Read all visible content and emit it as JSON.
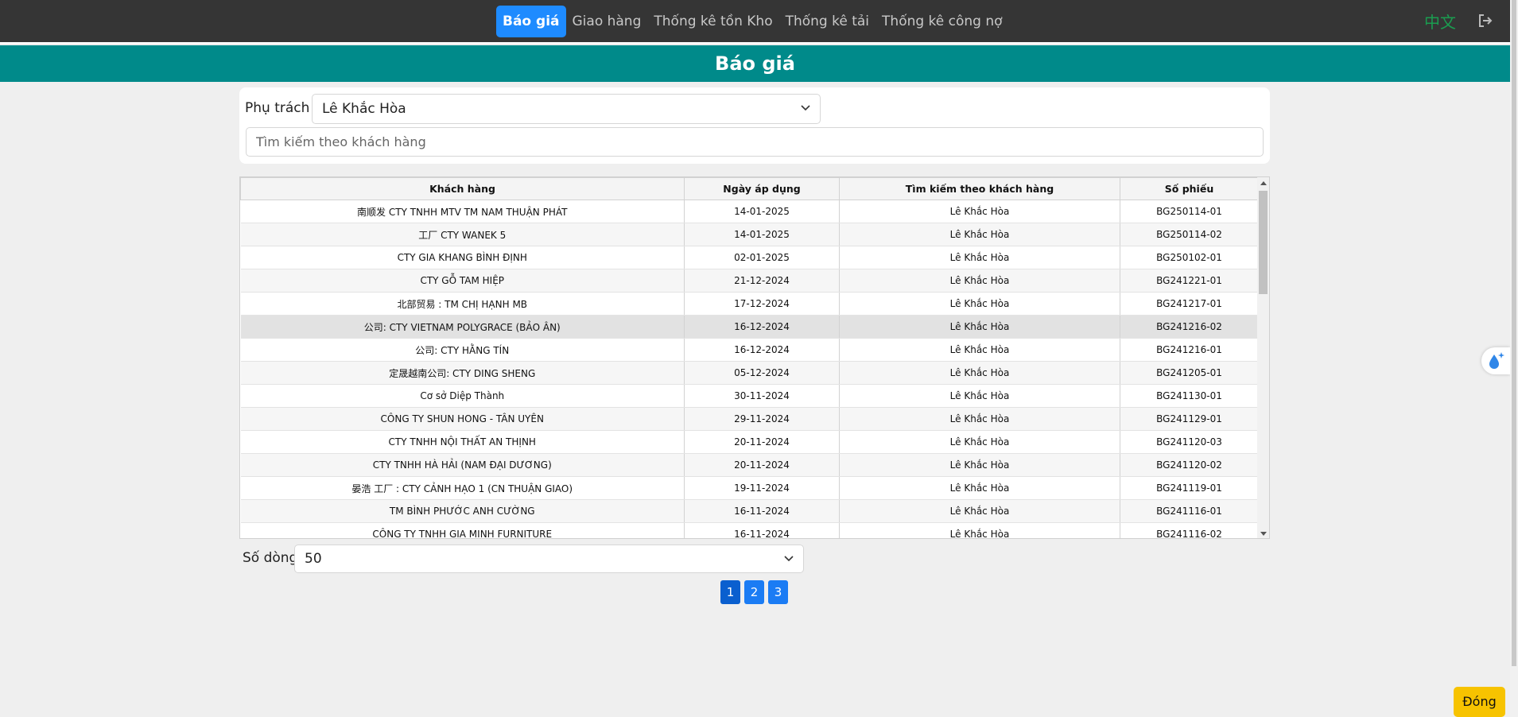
{
  "nav": {
    "tabs": [
      "Báo giá",
      "Giao hàng",
      "Thống kê tồn Kho",
      "Thống kê tải",
      "Thống kê công nợ"
    ],
    "active_index": 0,
    "language": "中文",
    "logout_icon": "logout-icon"
  },
  "page_title": "Báo giá",
  "filter": {
    "label": "Phụ trách",
    "selected": "Lê Khắc Hòa",
    "search_placeholder": "Tìm kiếm theo khách hàng"
  },
  "table": {
    "columns": [
      "Khách hàng",
      "Ngày áp dụng",
      "Tìm kiếm theo khách hàng",
      "Số phiếu"
    ],
    "rows": [
      [
        "南顺发 CTY TNHH MTV TM NAM THUẬN PHÁT",
        "14-01-2025",
        "Lê Khắc Hòa",
        "BG250114-01"
      ],
      [
        "工厂 CTY WANEK 5",
        "14-01-2025",
        "Lê Khắc Hòa",
        "BG250114-02"
      ],
      [
        "CTY GIA KHANG BÌNH ĐỊNH",
        "02-01-2025",
        "Lê Khắc Hòa",
        "BG250102-01"
      ],
      [
        "CTY GỖ TAM HIỆP",
        "21-12-2024",
        "Lê Khắc Hòa",
        "BG241221-01"
      ],
      [
        "北部贸易 : TM CHỊ HẠNH MB",
        "17-12-2024",
        "Lê Khắc Hòa",
        "BG241217-01"
      ],
      [
        "公司: CTY VIETNAM POLYGRACE (BẢO ÂN)",
        "16-12-2024",
        "Lê Khắc Hòa",
        "BG241216-02"
      ],
      [
        "公司: CTY HẰNG TÍN",
        "16-12-2024",
        "Lê Khắc Hòa",
        "BG241216-01"
      ],
      [
        "定晟越南公司: CTY DING SHENG",
        "05-12-2024",
        "Lê Khắc Hòa",
        "BG241205-01"
      ],
      [
        "Cơ sở Diệp Thành",
        "30-11-2024",
        "Lê Khắc Hòa",
        "BG241130-01"
      ],
      [
        "CÔNG TY SHUN HONG - TÂN UYÊN",
        "29-11-2024",
        "Lê Khắc Hòa",
        "BG241129-01"
      ],
      [
        "CTY TNHH NỘI THẤT AN THỊNH",
        "20-11-2024",
        "Lê Khắc Hòa",
        "BG241120-03"
      ],
      [
        "CTY TNHH HÀ HẢI (NAM ĐẠI DƯƠNG)",
        "20-11-2024",
        "Lê Khắc Hòa",
        "BG241120-02"
      ],
      [
        "晏浩 工厂 : CTY CẢNH HẠO 1 (CN THUẬN GIAO)",
        "19-11-2024",
        "Lê Khắc Hòa",
        "BG241119-01"
      ],
      [
        "TM BÌNH PHƯỚC ANH CƯỜNG",
        "16-11-2024",
        "Lê Khắc Hòa",
        "BG241116-01"
      ],
      [
        "CÔNG TY TNHH GIA MINH FURNITURE",
        "16-11-2024",
        "Lê Khắc Hòa",
        "BG241116-02"
      ]
    ],
    "highlighted_row": 5
  },
  "rows_per_page": {
    "label": "Số dòng:",
    "value": "50"
  },
  "pagination": {
    "pages": [
      "1",
      "2",
      "3"
    ],
    "current": 0
  },
  "close_button": "Đóng"
}
